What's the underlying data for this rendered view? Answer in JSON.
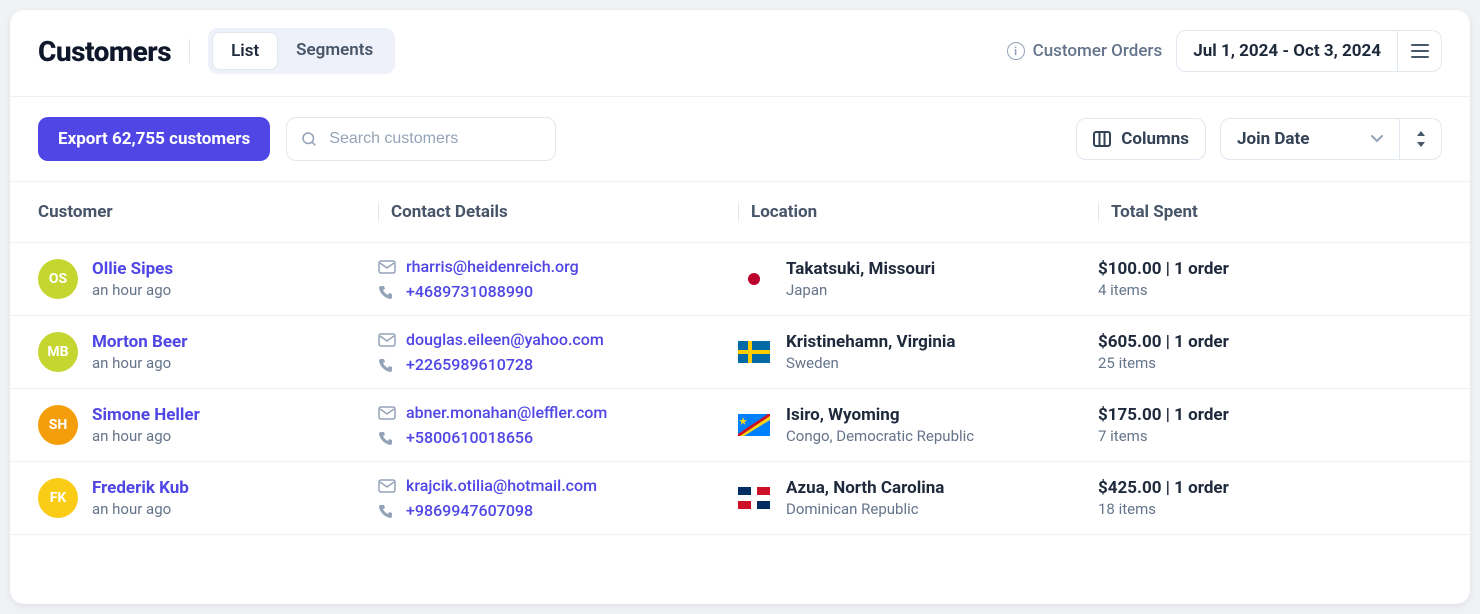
{
  "header": {
    "title": "Customers",
    "tabs": {
      "list": "List",
      "segments": "Segments"
    },
    "customer_orders_label": "Customer Orders",
    "date_range": "Jul 1, 2024 - Oct 3, 2024"
  },
  "toolbar": {
    "export_label": "Export 62,755 customers",
    "search_placeholder": "Search customers",
    "columns_label": "Columns",
    "sort_label": "Join Date"
  },
  "table": {
    "headers": {
      "customer": "Customer",
      "contact": "Contact Details",
      "location": "Location",
      "spent": "Total Spent"
    },
    "rows": [
      {
        "initials": "OS",
        "avatar_color": "#c5d631",
        "name": "Ollie Sipes",
        "time": "an hour ago",
        "email": "rharris@heidenreich.org",
        "phone": "+4689731088990",
        "city": "Takatsuki, Missouri",
        "country": "Japan",
        "country_code": "jp",
        "spent": "$100.00 | 1 order",
        "items": "4 items"
      },
      {
        "initials": "MB",
        "avatar_color": "#c5d631",
        "name": "Morton Beer",
        "time": "an hour ago",
        "email": "douglas.eileen@yahoo.com",
        "phone": "+2265989610728",
        "city": "Kristinehamn, Virginia",
        "country": "Sweden",
        "country_code": "se",
        "spent": "$605.00 | 1 order",
        "items": "25 items"
      },
      {
        "initials": "SH",
        "avatar_color": "#f59e0b",
        "name": "Simone Heller",
        "time": "an hour ago",
        "email": "abner.monahan@leffler.com",
        "phone": "+5800610018656",
        "city": "Isiro, Wyoming",
        "country": "Congo, Democratic Republic",
        "country_code": "cd",
        "spent": "$175.00 | 1 order",
        "items": "7 items"
      },
      {
        "initials": "FK",
        "avatar_color": "#facc15",
        "name": "Frederik Kub",
        "time": "an hour ago",
        "email": "krajcik.otilia@hotmail.com",
        "phone": "+9869947607098",
        "city": "Azua, North Carolina",
        "country": "Dominican Republic",
        "country_code": "do",
        "spent": "$425.00 | 1 order",
        "items": "18 items"
      }
    ]
  }
}
